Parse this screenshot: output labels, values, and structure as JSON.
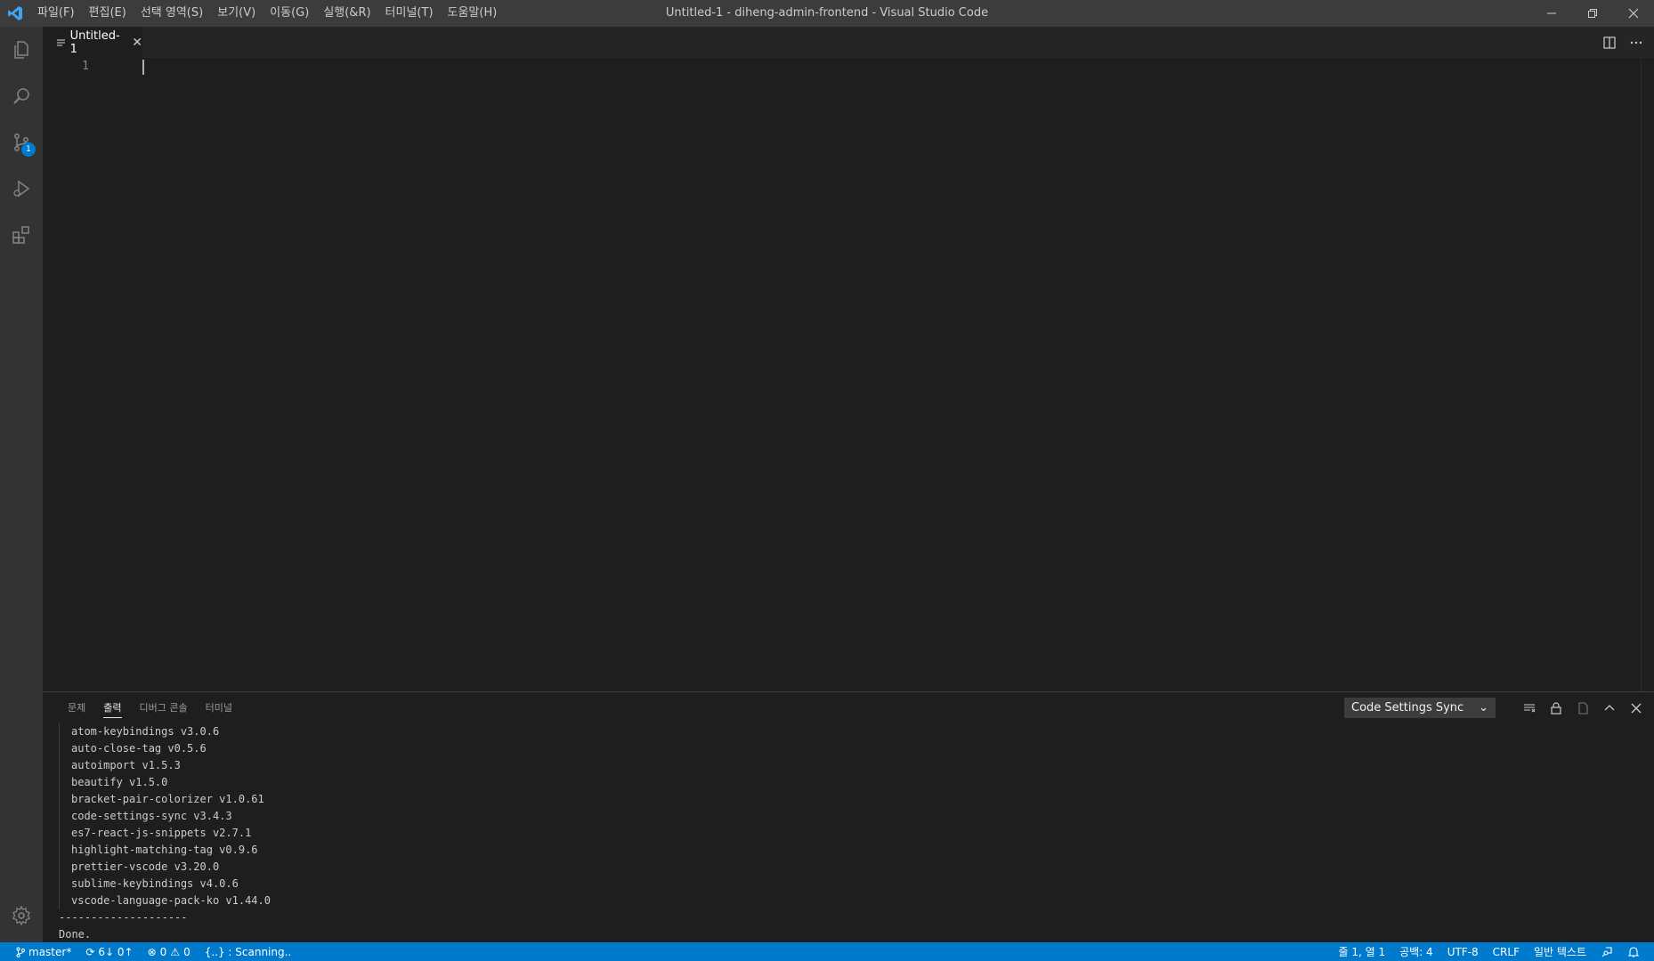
{
  "window": {
    "title": "Untitled-1 - diheng-admin-frontend - Visual Studio Code",
    "menu": [
      "파일(F)",
      "편집(E)",
      "선택 영역(S)",
      "보기(V)",
      "이동(G)",
      "실행(&R)",
      "터미널(T)",
      "도움말(H)"
    ]
  },
  "activitybar": {
    "items": [
      {
        "name": "explorer",
        "icon": "files-icon"
      },
      {
        "name": "search",
        "icon": "search-icon"
      },
      {
        "name": "source-control",
        "icon": "source-control-icon",
        "badge": "1"
      },
      {
        "name": "run",
        "icon": "run-debug-icon"
      },
      {
        "name": "extensions",
        "icon": "extensions-icon"
      }
    ],
    "bottom_icon": "gear-icon"
  },
  "editor": {
    "tab_label": "Untitled-1",
    "line_numbers": [
      "1"
    ]
  },
  "panel": {
    "tabs": [
      "문제",
      "출력",
      "디버그 콘솔",
      "터미널"
    ],
    "active_tab": "출력",
    "output_channel": "Code Settings Sync",
    "output_list": [
      "atom-keybindings v3.0.6",
      "auto-close-tag v0.5.6",
      "autoimport v1.5.3",
      "beautify v1.5.0",
      "bracket-pair-colorizer v1.0.61",
      "code-settings-sync v3.4.3",
      "es7-react-js-snippets v2.7.1",
      "highlight-matching-tag v0.9.6",
      "prettier-vscode v3.20.0",
      "sublime-keybindings v4.0.6",
      "vscode-language-pack-ko v1.44.0"
    ],
    "separator": "--------------------",
    "done": "Done."
  },
  "statusbar": {
    "branch": "master*",
    "sync": "6↓ 0↑",
    "errors": "0",
    "warnings": "0",
    "scanning": "{..} : Scanning..",
    "position": "줄 1, 열 1",
    "spaces": "공백: 4",
    "encoding": "UTF-8",
    "eol": "CRLF",
    "language": "일반 텍스트"
  },
  "colors": {
    "statusbar": "#007acc",
    "activitybar": "#333333",
    "titlebar": "#3c3c3c",
    "editor": "#1e1e1e"
  }
}
